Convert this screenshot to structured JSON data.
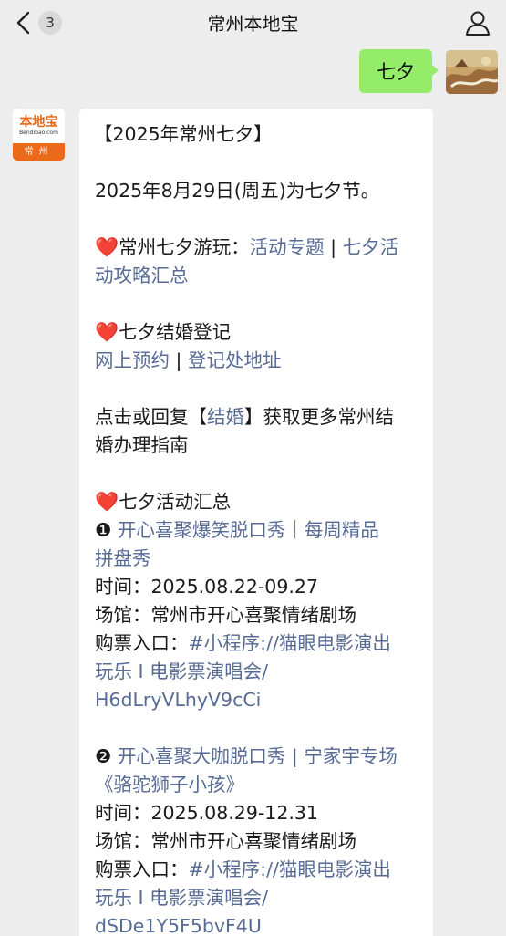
{
  "nav": {
    "back_count": "3",
    "title": "常州本地宝"
  },
  "own_message": {
    "text": "七夕"
  },
  "bot": {
    "avatar_logo": "本地宝",
    "avatar_sub": "Bendibao.com",
    "avatar_city": "常州"
  },
  "reply": {
    "l01": "【2025年常州七夕】",
    "l02": "2025年8月29日(周五)为七夕节。",
    "heart": "❤️",
    "l03a": "常州七夕游玩：",
    "l03b": "活动专题",
    "l03c": " | ",
    "l03d": "七夕活",
    "l04a": "动攻略汇总",
    "l05a": "七夕结婚登记",
    "l06a": "网上预约",
    "l06b": " | ",
    "l06c": "登记处地址",
    "l07a": "点击或回复【",
    "l07b": "结婚",
    "l07c": "】获取更多常州结",
    "l08a": "婚办理指南",
    "l09a": "七夕活动汇总",
    "l10a": "❶ ",
    "l10b": "开心喜聚爆笑脱口秀｜每周精品",
    "l11a": "拼盘秀",
    "l12a": "时间：2025.08.22-09.27",
    "l13a": "场馆：常州市开心喜聚情绪剧场",
    "l14a": "购票入口：",
    "l14b": "#小程序://猫眼电影演出",
    "l15a": "玩乐 I 电影票演唱会/",
    "l16a": "H6dLryVLhyV9cCi",
    "l17a": "❷ ",
    "l17b": "开心喜聚大咖脱口秀 | 宁家宇专场",
    "l18a": "《骆驼狮子小孩》",
    "l19a": "时间：2025.08.29-12.31",
    "l20a": "场馆：常州市开心喜聚情绪剧场",
    "l21a": "购票入口：",
    "l21b": "#小程序://猫眼电影演出",
    "l22a": "玩乐 I 电影票演唱会/",
    "l23a": "dSDe1Y5F5bvF4U"
  },
  "colors": {
    "link": "#576b95",
    "own_bubble": "#95ec69",
    "background": "#ededed"
  }
}
